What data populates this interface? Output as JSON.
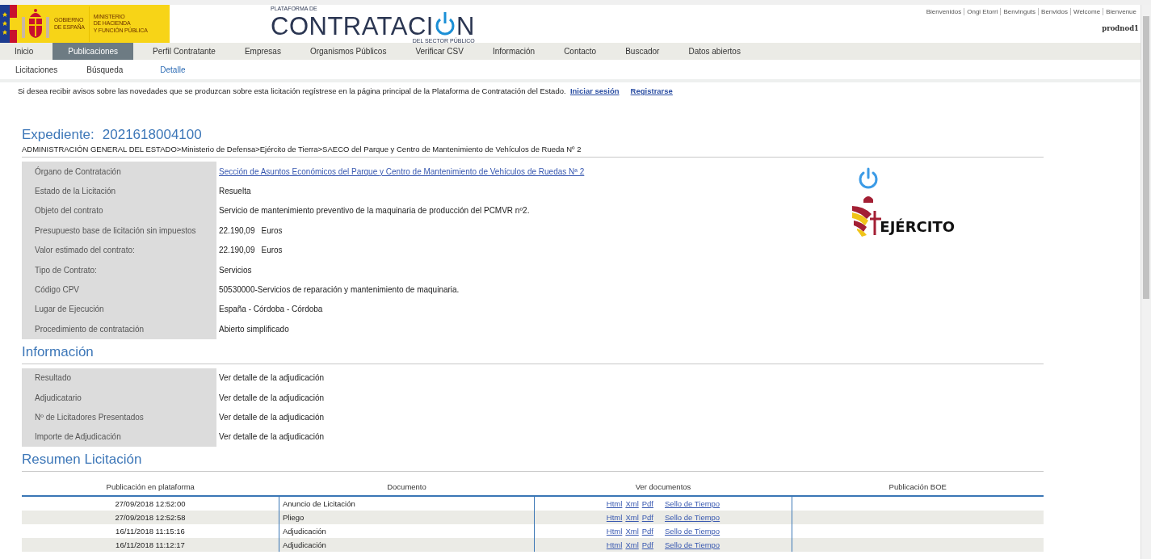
{
  "header": {
    "gov_logo": {
      "line1": "GOBIERNO",
      "line2": "DE ESPAÑA",
      "ministry": [
        "MINISTERIO",
        "DE HACIENDA",
        "Y FUNCIÓN PÚBLICA"
      ]
    },
    "platform_logo": {
      "top": "PLATAFORMA DE",
      "main_start": "CONTRATACI",
      "main_end": "N",
      "bottom": "DEL SECTOR PÚBLICO"
    },
    "languages": [
      "Bienvenidos",
      "Ongi Etorri",
      "Benvinguts",
      "Benvidos",
      "Welcome",
      "Bienvenue"
    ],
    "user": "prodnod1"
  },
  "nav": [
    {
      "label": "Inicio",
      "selected": false
    },
    {
      "label": "Publicaciones",
      "selected": true
    },
    {
      "label": "Perfil Contratante",
      "selected": false
    },
    {
      "label": "Empresas",
      "selected": false
    },
    {
      "label": "Organismos Públicos",
      "selected": false
    },
    {
      "label": "Verificar CSV",
      "selected": false
    },
    {
      "label": "Información",
      "selected": false
    },
    {
      "label": "Contacto",
      "selected": false
    },
    {
      "label": "Buscador",
      "selected": false
    },
    {
      "label": "Datos abiertos",
      "selected": false
    }
  ],
  "subnav": [
    {
      "label": "Licitaciones",
      "selected": false
    },
    {
      "label": "Búsqueda",
      "selected": false
    },
    {
      "label": "Detalle",
      "selected": true
    }
  ],
  "notice": {
    "text": "Si desea recibir avisos sobre las novedades que se produzcan sobre esta licitación regístrese en la página principal de la Plataforma de Contratación del Estado.",
    "links": [
      "Iniciar sesión",
      "Registrarse"
    ]
  },
  "expediente": {
    "label": "Expediente:",
    "number": "2021618004100",
    "breadcrumb": "ADMINISTRACIÓN GENERAL DEL ESTADO>Ministerio de Defensa>Ejército de Tierra>SAECO del Parque y Centro de Mantenimiento de Vehículos de Rueda Nº 2"
  },
  "details": [
    {
      "label": "Órgano de Contratación",
      "value": "Sección de Asuntos Económicos del Parque y Centro de Mantenimiento de Vehículos de Ruedas Nª 2",
      "kind": "link"
    },
    {
      "label": "Estado de la Licitación",
      "value": "Resuelta",
      "kind": "text"
    },
    {
      "label": "Objeto del contrato",
      "value": "Servicio de mantenimiento preventivo de la maquinaria de producción del PCMVR nº2.",
      "kind": "text"
    },
    {
      "label": "Presupuesto base de licitación sin impuestos",
      "value": "22.190,09",
      "unit": "Euros",
      "kind": "amount"
    },
    {
      "label": "Valor estimado del contrato:",
      "value": "22.190,09",
      "unit": "Euros",
      "kind": "amount"
    },
    {
      "label": "Tipo de Contrato:",
      "value": "Servicios",
      "kind": "text"
    },
    {
      "label": "Código CPV",
      "value": "50530000-Servicios de reparación y mantenimiento de maquinaria.",
      "kind": "text"
    },
    {
      "label": "Lugar de Ejecución",
      "value": "España - Córdoba - Córdoba",
      "kind": "text"
    },
    {
      "label": "Procedimiento de contratación",
      "value": "Abierto simplificado",
      "kind": "text"
    }
  ],
  "organ_logo": {
    "name": "EJÉRCITO"
  },
  "informacion": {
    "title": "Información",
    "rows": [
      {
        "label": "Resultado",
        "value": "Ver detalle de la adjudicación"
      },
      {
        "label": "Adjudicatario",
        "value": "Ver detalle de la adjudicación"
      },
      {
        "label": "Nº de Licitadores Presentados",
        "value": "Ver detalle de la adjudicación"
      },
      {
        "label": "Importe de Adjudicación",
        "value": "Ver detalle de la adjudicación"
      }
    ]
  },
  "resumen": {
    "title": "Resumen Licitación",
    "columns": [
      "Publicación en plataforma",
      "Documento",
      "Ver documentos",
      "Publicación BOE"
    ],
    "rows": [
      {
        "date": "27/09/2018 12:52:00",
        "document": "Anuncio de Licitación",
        "links": [
          "Html",
          "Xml",
          "Pdf",
          "Sello de Tiempo"
        ]
      },
      {
        "date": "27/09/2018 12:52:58",
        "document": "Pliego",
        "links": [
          "Html",
          "Xml",
          "Pdf",
          "Sello de Tiempo"
        ]
      },
      {
        "date": "16/11/2018 11:15:16",
        "document": "Adjudicación",
        "links": [
          "Html",
          "Xml",
          "Pdf",
          "Sello de Tiempo"
        ]
      },
      {
        "date": "16/11/2018 11:12:17",
        "document": "Adjudicación",
        "links": [
          "Html",
          "Xml",
          "Pdf",
          "Sello de Tiempo"
        ]
      }
    ]
  }
}
